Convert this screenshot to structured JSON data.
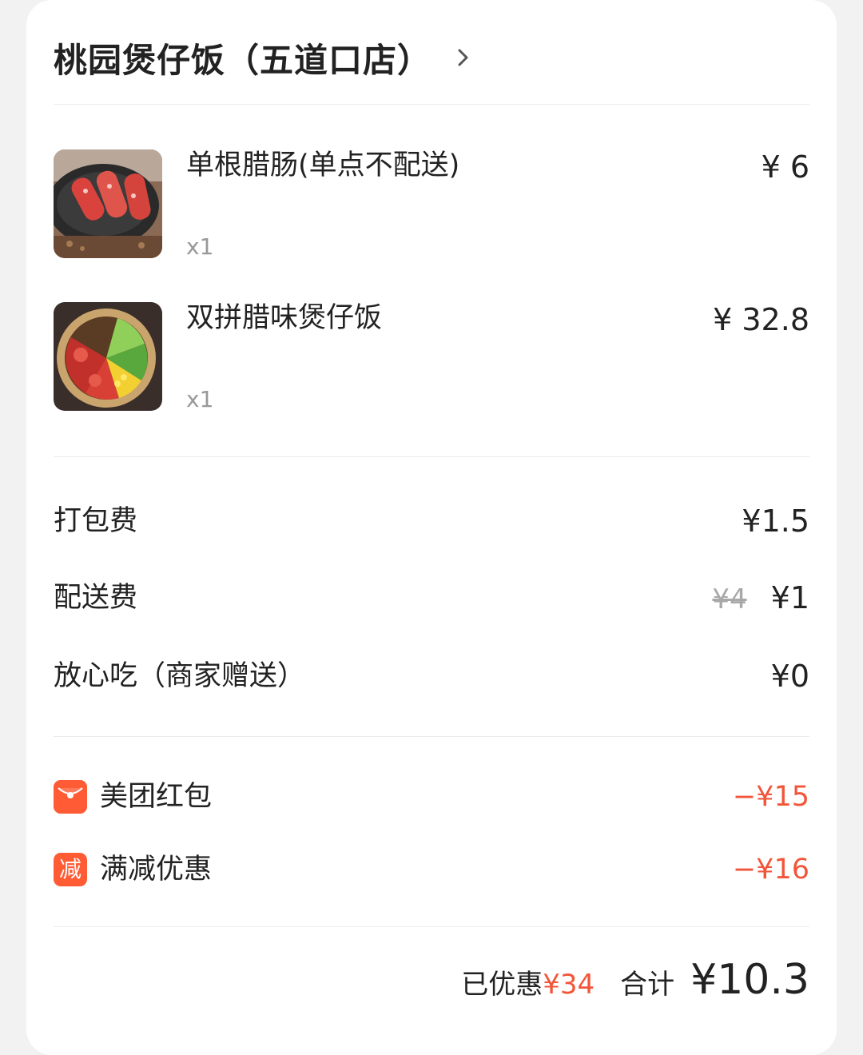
{
  "store": {
    "name": "桃园煲仔饭（五道口店）"
  },
  "items": [
    {
      "name": "单根腊肠(单点不配送)",
      "qty": "x1",
      "price": "¥ 6",
      "image": "sausage-photo"
    },
    {
      "name": "双拼腊味煲仔饭",
      "qty": "x1",
      "price": "¥ 32.8",
      "image": "claypot-rice-photo"
    }
  ],
  "fees": {
    "packing": {
      "label": "打包费",
      "value": "¥1.5"
    },
    "delivery": {
      "label": "配送费",
      "original": "¥4",
      "value": "¥1"
    },
    "assurance": {
      "label": "放心吃（商家赠送）",
      "value": "¥0"
    }
  },
  "discounts": {
    "red_packet": {
      "icon": "red-envelope-icon",
      "label": "美团红包",
      "value": "−¥15"
    },
    "full_reduction": {
      "icon_text": "减",
      "label": "满减优惠",
      "value": "−¥16"
    }
  },
  "summary": {
    "saved_label": "已优惠",
    "saved_value": "¥34",
    "total_label": "合计",
    "total_value": "¥10.3"
  },
  "colors": {
    "accent_red": "#f2563a",
    "icon_orange": "#ff5c35",
    "muted_gray": "#999999"
  }
}
